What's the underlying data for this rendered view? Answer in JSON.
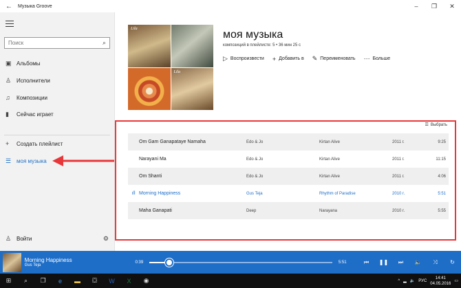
{
  "window": {
    "title": "Музыка Groove",
    "back_icon": "arrow-left-icon"
  },
  "sidebar": {
    "search_placeholder": "Поиск",
    "items": [
      {
        "label": "Альбомы",
        "icon": "album-icon"
      },
      {
        "label": "Исполнители",
        "icon": "artist-icon"
      },
      {
        "label": "Композиции",
        "icon": "note-icon"
      },
      {
        "label": "Сейчас играет",
        "icon": "equalizer-icon"
      },
      {
        "label": "Создать плейлист",
        "icon": "plus-icon"
      },
      {
        "label": "моя музыка",
        "icon": "playlist-icon",
        "active": true
      }
    ],
    "sign_in": "Войти"
  },
  "playlist": {
    "title": "моя музыка",
    "meta": "композиций в плейлисте: 5 • 36 мин 25 с",
    "cover_labels": [
      "Lila",
      "Lila"
    ],
    "actions": [
      {
        "label": "Воспроизвести",
        "icon": "play-icon"
      },
      {
        "label": "Добавить в",
        "icon": "plus-icon"
      },
      {
        "label": "Переименовать",
        "icon": "pencil-icon"
      },
      {
        "label": "Больше",
        "icon": "more-icon"
      }
    ],
    "select_label": "Выбрать"
  },
  "tracks": [
    {
      "name": "Om Gam Ganapataye Namaha",
      "artist": "Edo & Jo",
      "album": "Kirtan Alive",
      "year": "2011 г.",
      "duration": "9:25"
    },
    {
      "name": "Narayani Ma",
      "artist": "Edo & Jo",
      "album": "Kirtan Alive",
      "year": "2011 г.",
      "duration": "11:15"
    },
    {
      "name": "Om Shanti",
      "artist": "Edo & Jo",
      "album": "Kirtan Alive",
      "year": "2011 г.",
      "duration": "4:06"
    },
    {
      "name": "Morning Happiness",
      "artist": "Gus Teja",
      "album": "Rhythm of Paradise",
      "year": "2010 г.",
      "duration": "5:51",
      "playing": true
    },
    {
      "name": "Maha Ganapati",
      "artist": "Deep",
      "album": "Narayana",
      "year": "2010 г.",
      "duration": "5:55"
    }
  ],
  "player": {
    "title": "Morning Happiness",
    "artist": "Gus Teja",
    "elapsed": "0:39",
    "total": "5:51",
    "progress_fraction": 0.11
  },
  "taskbar": {
    "lang": "РУС",
    "time": "14:41",
    "date": "04.05.2016"
  },
  "colors": {
    "accent": "#1e6ec8",
    "annotation": "#e8373a"
  }
}
